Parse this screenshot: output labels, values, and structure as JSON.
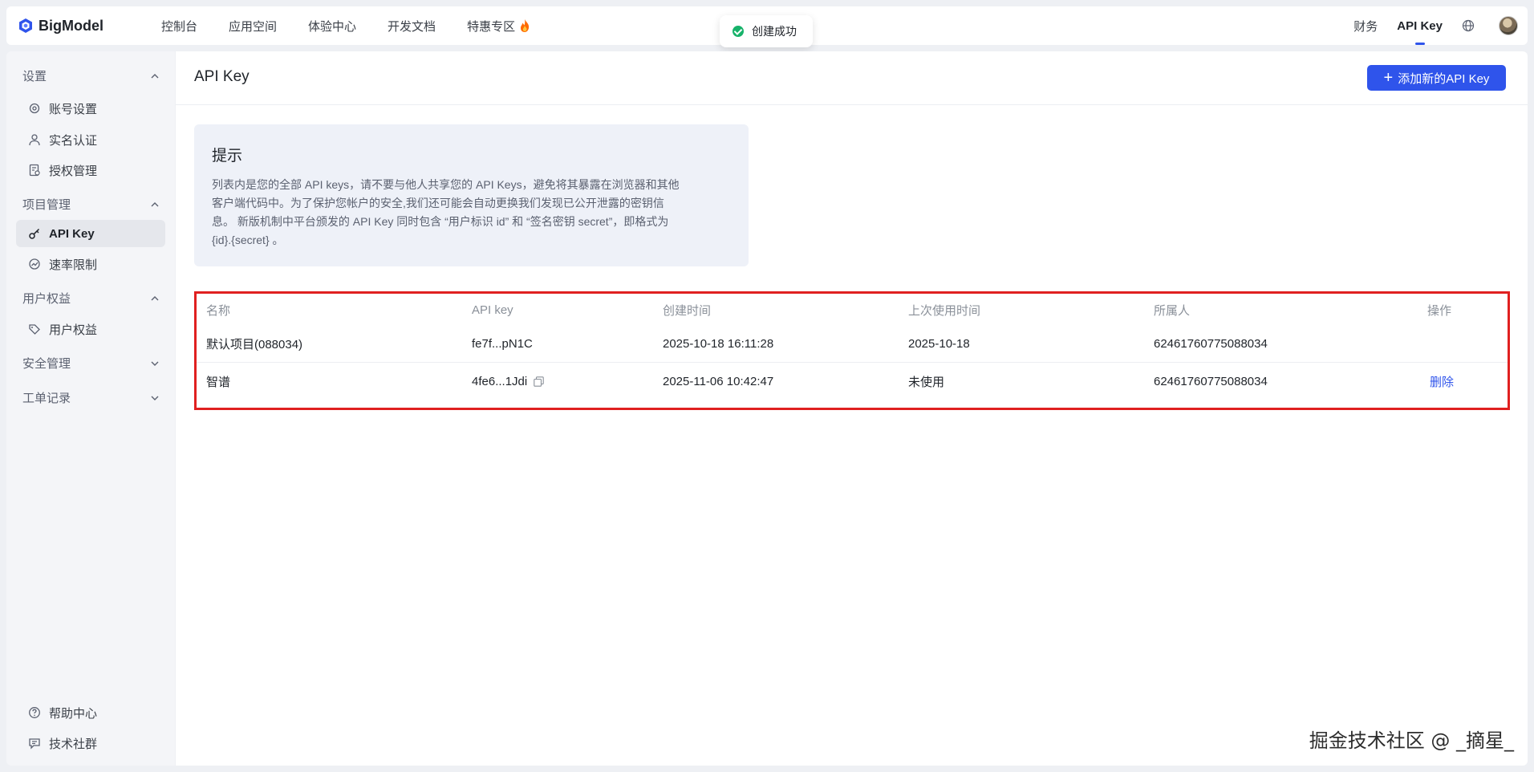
{
  "brand": {
    "name": "BigModel",
    "accent": "#2f54eb"
  },
  "nav": {
    "items": [
      "控制台",
      "应用空间",
      "体验中心",
      "开发文档",
      "特惠专区"
    ],
    "right": {
      "finance": "财务",
      "api_key": "API Key"
    },
    "icons": [
      "flame-icon",
      "globe-icon",
      "avatar"
    ]
  },
  "toast": {
    "text": "创建成功",
    "status_color": "#17b26a"
  },
  "sidebar": {
    "groups": [
      {
        "label": "设置",
        "expanded": true,
        "items": [
          {
            "label": "账号设置",
            "icon": "gear-icon"
          },
          {
            "label": "实名认证",
            "icon": "user-icon"
          },
          {
            "label": "授权管理",
            "icon": "document-icon"
          }
        ]
      },
      {
        "label": "项目管理",
        "expanded": true,
        "items": [
          {
            "label": "API Key",
            "icon": "key-icon",
            "active": true
          },
          {
            "label": "速率限制",
            "icon": "speed-icon"
          }
        ]
      },
      {
        "label": "用户权益",
        "expanded": true,
        "items": [
          {
            "label": "用户权益",
            "icon": "tag-icon"
          }
        ]
      },
      {
        "label": "安全管理",
        "expanded": false,
        "items": []
      },
      {
        "label": "工单记录",
        "expanded": false,
        "items": []
      }
    ],
    "footer": [
      {
        "label": "帮助中心",
        "icon": "help-icon"
      },
      {
        "label": "技术社群",
        "icon": "chat-icon"
      }
    ]
  },
  "main": {
    "title": "API Key",
    "add_button": "添加新的API Key",
    "tip": {
      "title": "提示",
      "lines": [
        "列表内是您的全部 API keys，请不要与他人共享您的 API Keys，避免将其暴露在浏览器和其他",
        "客户端代码中。为了保护您帐户的安全,我们还可能会自动更换我们发现已公开泄露的密钥信",
        "息。 新版机制中平台颁发的 API Key 同时包含 “用户标识 id” 和 “签名密钥 secret”，即格式为",
        "{id}.{secret} 。"
      ]
    },
    "table": {
      "headers": [
        "名称",
        "API key",
        "创建时间",
        "上次使用时间",
        "所属人",
        "操作"
      ],
      "rows": [
        {
          "name": "默认项目(088034)",
          "key": "fe7f...pN1C",
          "created": "2025-10-18 16:11:28",
          "last_used": "2025-10-18",
          "owner": "62461760775088034",
          "action": ""
        },
        {
          "name": "智谱",
          "key": "4fe6...1Jdi",
          "created": "2025-11-06 10:42:47",
          "last_used": "未使用",
          "owner": "62461760775088034",
          "action": "删除"
        }
      ]
    }
  },
  "watermark": "掘金技术社区 @ _摘星_"
}
